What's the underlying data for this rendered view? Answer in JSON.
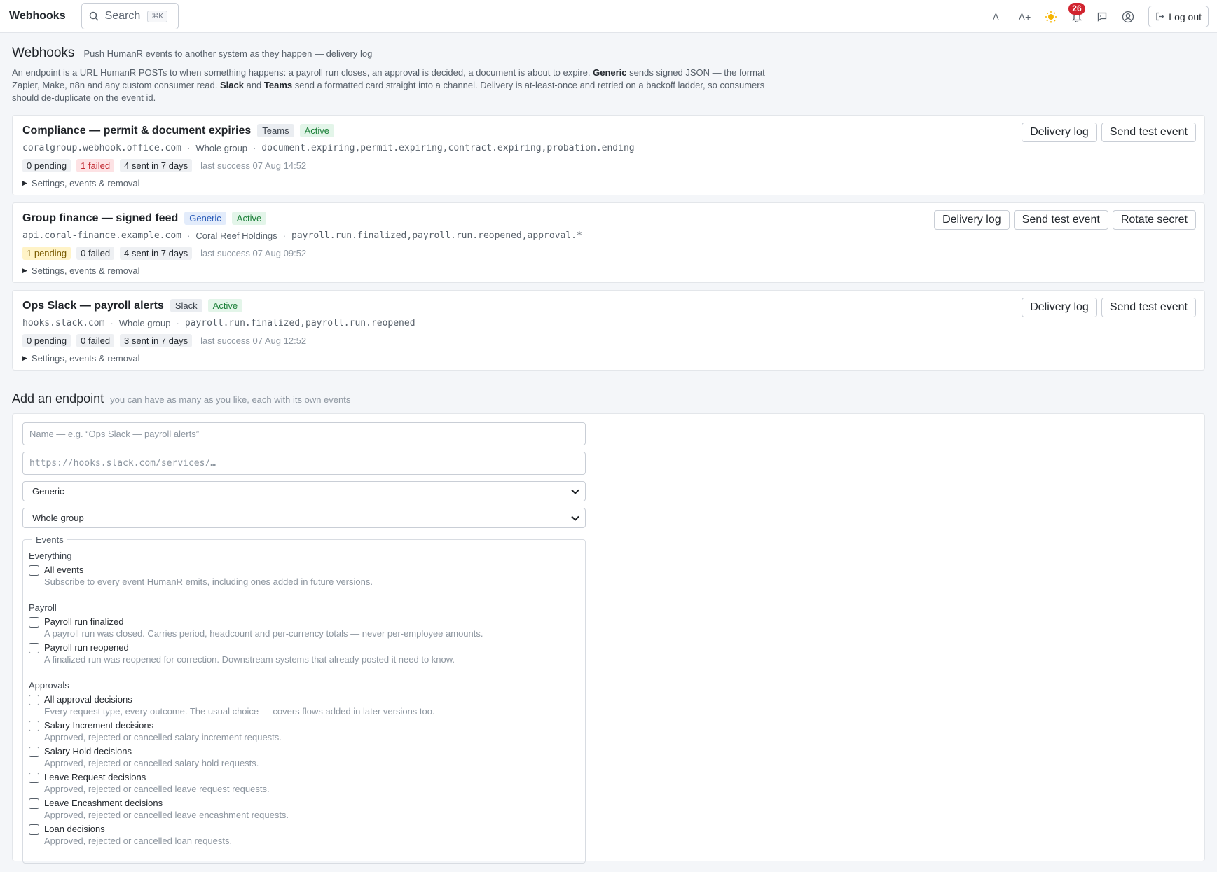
{
  "topbar": {
    "brand": "Webhooks",
    "search_label": "Search",
    "search_shortcut": "⌘K",
    "font_decrease": "A–",
    "font_increase": "A+",
    "notifications_count": "26",
    "logout_label": "Log out"
  },
  "header": {
    "title": "Webhooks",
    "subtitle": "Push HumanR events to another system as they happen — delivery log",
    "intro_1": "An endpoint is a URL HumanR POSTs to when something happens: a payroll run closes, an approval is decided, a document is about to expire. ",
    "intro_generic": "Generic",
    "intro_2": " sends signed JSON — the format Zapier, Make, n8n and any custom consumer read. ",
    "intro_slack": "Slack",
    "intro_3": " and ",
    "intro_teams": "Teams",
    "intro_4": " send a formatted card straight into a channel. Delivery is at-least-once and retried on a backoff ladder, so consumers should de-duplicate on the event id."
  },
  "endpoints": [
    {
      "name": "Compliance — permit & document expiries",
      "kind": "Teams",
      "status": "Active",
      "host": "coralgroup.webhook.office.com",
      "scope": "Whole group",
      "events": "document.expiring,permit.expiring,contract.expiring,probation.ending",
      "pending": "0 pending",
      "failed": "1 failed",
      "sent": "4 sent in 7 days",
      "last_success": "last success 07 Aug 14:52",
      "settings": "Settings, events & removal",
      "actions": [
        "Delivery log",
        "Send test event"
      ]
    },
    {
      "name": "Group finance — signed feed",
      "kind": "Generic",
      "status": "Active",
      "host": "api.coral-finance.example.com",
      "scope": "Coral Reef Holdings",
      "events": "payroll.run.finalized,payroll.run.reopened,approval.*",
      "pending": "1 pending",
      "failed": "0 failed",
      "sent": "4 sent in 7 days",
      "last_success": "last success 07 Aug 09:52",
      "settings": "Settings, events & removal",
      "actions": [
        "Delivery log",
        "Send test event",
        "Rotate secret"
      ]
    },
    {
      "name": "Ops Slack — payroll alerts",
      "kind": "Slack",
      "status": "Active",
      "host": "hooks.slack.com",
      "scope": "Whole group",
      "events": "payroll.run.finalized,payroll.run.reopened",
      "pending": "0 pending",
      "failed": "0 failed",
      "sent": "3 sent in 7 days",
      "last_success": "last success 07 Aug 12:52",
      "settings": "Settings, events & removal",
      "actions": [
        "Delivery log",
        "Send test event"
      ]
    }
  ],
  "add": {
    "title": "Add an endpoint",
    "subtitle": "you can have as many as you like, each with its own events",
    "name_placeholder": "Name — e.g. “Ops Slack — payroll alerts”",
    "url_placeholder": "https://hooks.slack.com/services/…",
    "kind_value": "Generic",
    "scope_value": "Whole group",
    "events_legend": "Events",
    "groups": {
      "everything": "Everything",
      "payroll": "Payroll",
      "approvals": "Approvals"
    },
    "options": {
      "all_events": {
        "label": "All events",
        "desc": "Subscribe to every event HumanR emits, including ones added in future versions."
      },
      "payroll_finalized": {
        "label": "Payroll run finalized",
        "desc": "A payroll run was closed. Carries period, headcount and per-currency totals — never per-employee amounts."
      },
      "payroll_reopened": {
        "label": "Payroll run reopened",
        "desc": "A finalized run was reopened for correction. Downstream systems that already posted it need to know."
      },
      "all_approvals": {
        "label": "All approval decisions",
        "desc": "Every request type, every outcome. The usual choice — covers flows added in later versions too."
      },
      "salary_increment": {
        "label": "Salary Increment decisions",
        "desc": "Approved, rejected or cancelled salary increment requests."
      },
      "salary_hold": {
        "label": "Salary Hold decisions",
        "desc": "Approved, rejected or cancelled salary hold requests."
      },
      "leave_request": {
        "label": "Leave Request decisions",
        "desc": "Approved, rejected or cancelled leave request requests."
      },
      "leave_encashment": {
        "label": "Leave Encashment decisions",
        "desc": "Approved, rejected or cancelled leave encashment requests."
      },
      "loan": {
        "label": "Loan decisions",
        "desc": "Approved, rejected or cancelled loan requests."
      }
    }
  }
}
